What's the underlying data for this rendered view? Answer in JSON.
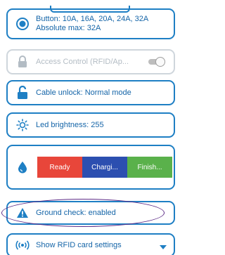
{
  "colors": {
    "accent": "#1e7fc4",
    "ready": "#e8463a",
    "charging": "#2c4fb0",
    "finish": "#5ab14b",
    "annotation": "#5b2a86",
    "disabled": "#cfd6dc"
  },
  "cards": {
    "button_current": {
      "line1": "Button: 10A, 16A, 20A, 24A, 32A",
      "line2": "Absolute max: 32A",
      "icon": "radio-selected-icon"
    },
    "access_control": {
      "label": "Access Control (RFID/Ap...",
      "icon": "lock-icon",
      "enabled": false
    },
    "cable_unlock": {
      "label": "Cable unlock: Normal mode",
      "icon": "unlock-icon"
    },
    "led_brightness": {
      "label": "Led brightness: 255",
      "icon": "brightness-icon"
    },
    "led_states": {
      "icon": "drop-icon",
      "segments": [
        "Ready",
        "Chargi...",
        "Finish..."
      ]
    },
    "ground_check": {
      "label": "Ground check: enabled",
      "icon": "warning-icon"
    },
    "rfid": {
      "label": "Show RFID card settings",
      "icon": "rfid-icon"
    }
  }
}
